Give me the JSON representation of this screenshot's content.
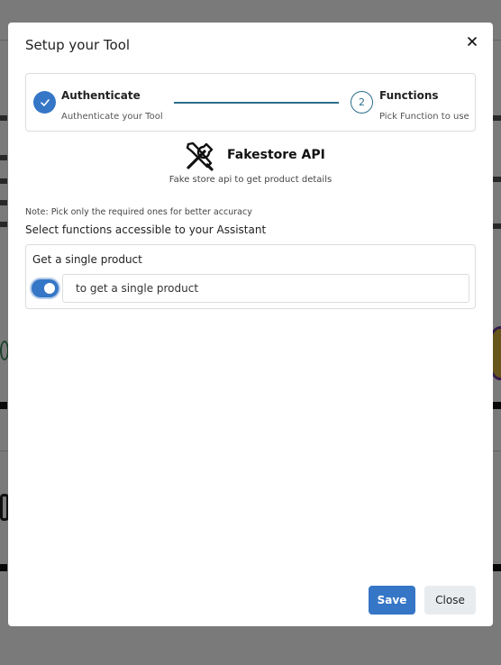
{
  "modal": {
    "title": "Setup your Tool",
    "stepper": {
      "step1": {
        "title": "Authenticate",
        "subtitle": "Authenticate your Tool",
        "status": "completed"
      },
      "step2": {
        "number": "2",
        "title": "Functions",
        "subtitle": "Pick Function to use",
        "status": "active"
      }
    },
    "tool": {
      "icon": "wrench-screwdriver-icon",
      "name": "Fakestore API",
      "description": "Fake store api to get product details"
    },
    "note": "Note: Pick only the required ones for better accuracy",
    "section_label": "Select functions accessible to your Assistant",
    "functions": [
      {
        "name": "Get a single product",
        "description": "to get a single product",
        "enabled": true
      }
    ],
    "buttons": {
      "save": "Save",
      "close": "Close"
    }
  },
  "colors": {
    "primary": "#3576c6",
    "connector": "#2c6e8a",
    "secondary_button": "#e9ecef"
  }
}
